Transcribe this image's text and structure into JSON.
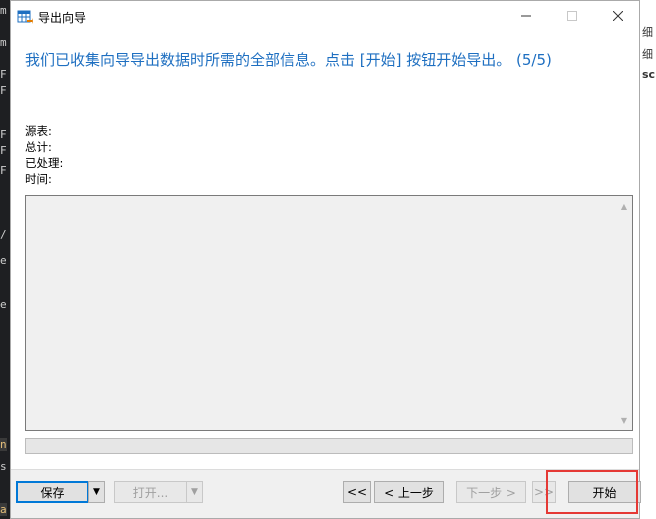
{
  "window": {
    "title": "导出向导",
    "minimize_icon": "minimize-icon",
    "maximize_icon": "maximize-icon",
    "close_icon": "close-icon"
  },
  "headline": "我们已收集向导导出数据时所需的全部信息。点击 [开始] 按钮开始导出。 (5/5)",
  "info": {
    "source_label": "源表:",
    "total_label": "总计:",
    "processed_label": "已处理:",
    "time_label": "时间:"
  },
  "log": {
    "up_arrow": "▲",
    "down_arrow": "▼"
  },
  "footer": {
    "save_label": "保存",
    "save_arrow": "▼",
    "open_label": "打开...",
    "open_arrow": "▼",
    "first_label": "<<",
    "prev_label": "< 上一步",
    "next_label": "下一步 >",
    "last_label": ">>",
    "start_label": "开始"
  },
  "background": {
    "right_chars": [
      "细",
      "细",
      "sc"
    ],
    "left_chars": [
      "m",
      "m",
      "F",
      "F",
      "F",
      "F",
      "F",
      "/",
      "e",
      "e",
      "n",
      "s",
      "a"
    ]
  },
  "colors": {
    "accent": "#1e6fc1",
    "highlight": "#e53935"
  }
}
